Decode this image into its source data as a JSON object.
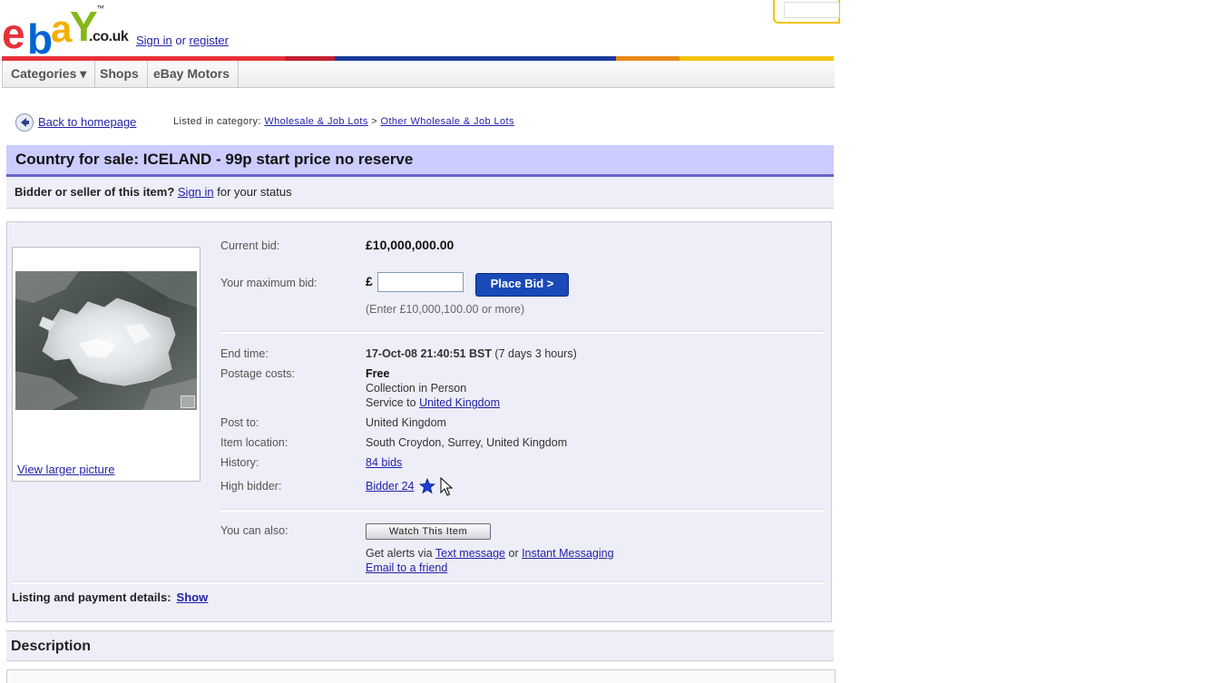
{
  "header": {
    "logo": {
      "e": "e",
      "b": "b",
      "a": "a",
      "y": "Y",
      "tm": "™",
      "domain": ".co.uk"
    },
    "signin_text": "Sign in",
    "or_text": " or ",
    "register_text": "register"
  },
  "nav": {
    "items": [
      {
        "label": "Categories ▾"
      },
      {
        "label": "Shops"
      },
      {
        "label": "eBay Motors"
      }
    ]
  },
  "breadcrumb": {
    "back_label": "Back to homepage",
    "listed_prefix": "Listed in category: ",
    "cat1": "Wholesale & Job Lots",
    "sep": " > ",
    "cat2": "Other Wholesale & Job Lots"
  },
  "listing": {
    "title": "Country for sale: ICELAND - 99p start price no reserve",
    "status_prefix": "Bidder or seller of this item?",
    "status_link": "Sign in",
    "status_suffix": " for your status"
  },
  "picture": {
    "view_larger": "View larger picture"
  },
  "bid": {
    "current_label": "Current bid:",
    "current_value": "£10,000,000.00",
    "max_label": "Your maximum bid:",
    "currency": "£",
    "input_value": "",
    "button": "Place Bid >",
    "hint": "(Enter £10,000,100.00 or more)"
  },
  "details": {
    "end_label": "End time:",
    "end_value": "17-Oct-08 21:40:51 BST",
    "end_remaining": " (7 days 3 hours)",
    "postage_label": "Postage costs:",
    "postage_value": "Free",
    "postage_method": "Collection in Person",
    "service_prefix": "Service to ",
    "service_link": "United Kingdom",
    "post_to_label": "Post to:",
    "post_to_value": "United Kingdom",
    "location_label": "Item location:",
    "location_value": "South Croydon, Surrey, United Kingdom",
    "history_label": "History:",
    "history_value": "84 bids",
    "high_bidder_label": "High bidder:",
    "high_bidder_value": "Bidder 24"
  },
  "also": {
    "label": "You can also:",
    "watch_button": "Watch This Item",
    "alerts_prefix": "Get alerts via ",
    "text_message": "Text message",
    "or": " or ",
    "instant_messaging": "Instant Messaging",
    "email_friend": "Email to a friend"
  },
  "payment": {
    "label": "Listing and payment details:",
    "show": "Show"
  },
  "description": {
    "title": "Description"
  },
  "colors": {
    "title_bg": "#ccccff",
    "title_border": "#6666cc",
    "panel_bg": "#eeeef8",
    "link": "#2222aa",
    "place_bid_bg": "#1a4ab8"
  }
}
